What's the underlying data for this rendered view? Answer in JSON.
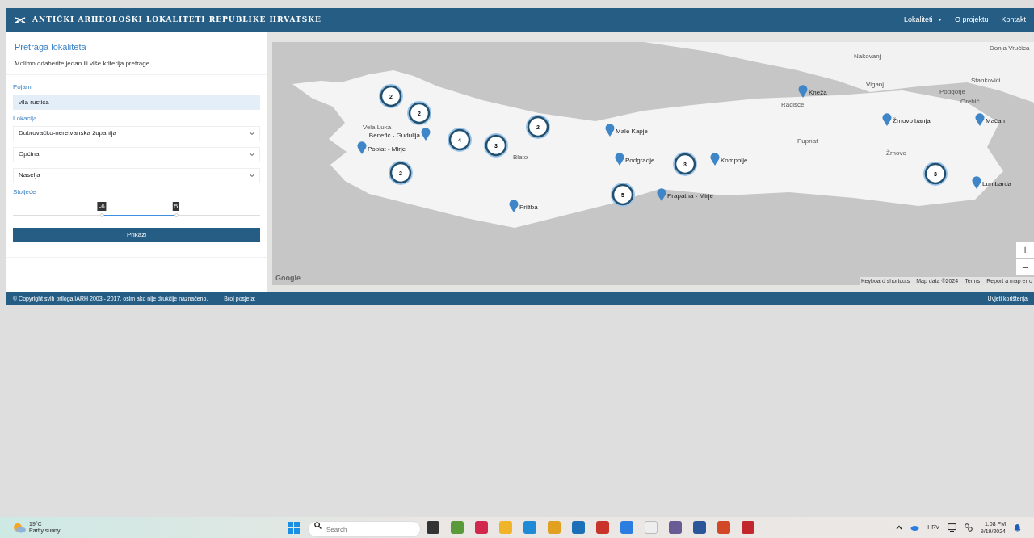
{
  "navbar": {
    "brand": "ANTIČKI ARHEOLOŠKI LOKALITETI REPUBLIKE HRVATSKE",
    "links": [
      {
        "label": "Lokaliteti",
        "dropdown": true
      },
      {
        "label": "O projektu",
        "dropdown": false
      },
      {
        "label": "Kontakt",
        "dropdown": false
      }
    ]
  },
  "search_panel": {
    "title": "Pretraga lokaliteta",
    "subtitle": "Molimo odaberite jedan ili više kriterija pretrage",
    "term_label": "Pojam",
    "term_value": "vila rustica",
    "location_label": "Lokacija",
    "selects": [
      {
        "value": "Dubrovačko-neretvanska županija"
      },
      {
        "value": "Općina"
      },
      {
        "value": "Naselja"
      }
    ],
    "century_label": "Stoljeće",
    "slider_handles": [
      {
        "label": "-6",
        "level": 0.36
      },
      {
        "label": "5",
        "level": 0.66
      }
    ],
    "button": "Prikaži"
  },
  "map": {
    "clusters": [
      {
        "count": "2"
      },
      {
        "count": "2"
      },
      {
        "count": "4"
      },
      {
        "count": "3"
      },
      {
        "count": "2"
      },
      {
        "count": "2"
      },
      {
        "count": "5"
      },
      {
        "count": "3"
      },
      {
        "count": "3"
      }
    ],
    "markers": [
      {
        "label": "Poplat - Mirje"
      },
      {
        "label": "Benefic - Gudulija"
      },
      {
        "label": "Prižba"
      },
      {
        "label": "Male Kapje"
      },
      {
        "label": "Podgradje"
      },
      {
        "label": "Prapatna - Mirje"
      },
      {
        "label": "Kompolje"
      },
      {
        "label": "Kneža"
      },
      {
        "label": "Žrnovo banja"
      },
      {
        "label": "Mačan"
      },
      {
        "label": "Lumbarda"
      }
    ],
    "place_names": [
      "Nakovanj",
      "Viganj",
      "Podgorje",
      "Stankovići",
      "Račišće",
      "Orebić",
      "Pupnat",
      "Žrnovo",
      "Blato",
      "Vela Luka",
      "Donja Vrućica"
    ],
    "zoom_in": "+",
    "zoom_out": "−",
    "logo": "Google",
    "attribution": [
      "Keyboard shortcuts",
      "Map data ©2024",
      "Terms",
      "Report a map erro"
    ]
  },
  "footer": {
    "copyright": "© Copyright svih priloga IARH 2003 - 2017, osim ako nije drukčije naznačeno.",
    "visits": "Broj posjeta:",
    "right": "Uvjeti korištenja"
  },
  "taskbar": {
    "temperature": "19°C",
    "weather": "Partly sunny",
    "search_placeholder": "Search",
    "language": "HRV",
    "time": "1:08 PM",
    "date": "9/19/2024"
  }
}
